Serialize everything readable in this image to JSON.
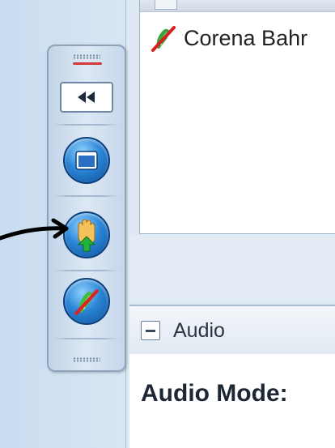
{
  "participants": {
    "rows": [
      {
        "name": "Corena Bahr",
        "icon": "muted-microphone-icon"
      }
    ]
  },
  "audio": {
    "section_title": "Audio",
    "mode_label": "Audio Mode:"
  },
  "toolbar": {
    "collapse_icon": "double-left-arrow-icon",
    "buttons": [
      {
        "name": "window-icon"
      },
      {
        "name": "raise-hand-icon"
      },
      {
        "name": "mute-microphone-icon"
      }
    ]
  },
  "annotation": {
    "arrow": "pointer-arrow-icon"
  }
}
